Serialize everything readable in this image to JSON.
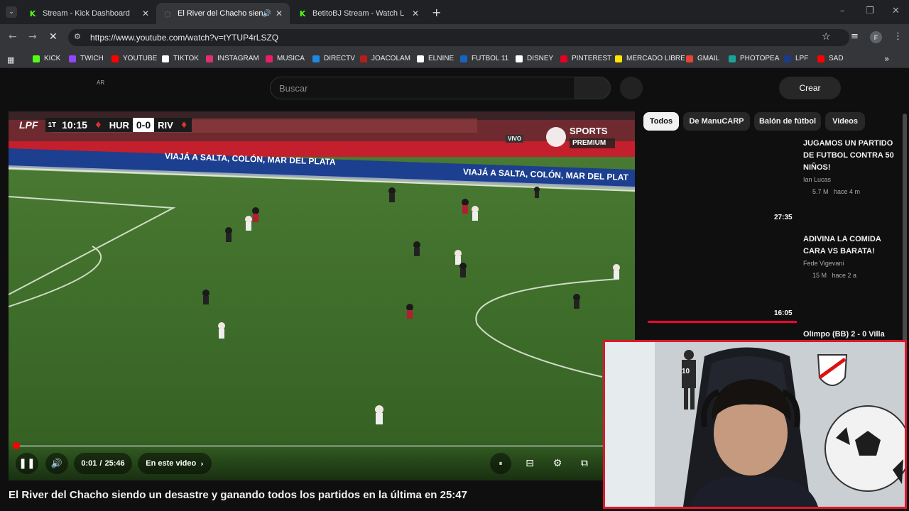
{
  "browser": {
    "tabs": [
      {
        "title": "Stream - Kick Dashboard",
        "favicon": "kick-icon"
      },
      {
        "title": "El River del Chacho siendo",
        "favicon": "youtube-loading-icon",
        "active": true
      },
      {
        "title": "BetitoBJ Stream - Watch Live o",
        "favicon": "kick-icon"
      }
    ],
    "url": "https://www.youtube.com/watch?v=tYTUP4rLSZQ",
    "profile_initial": "F",
    "bookmarks": [
      {
        "label": "KICK",
        "color": "#53fc18"
      },
      {
        "label": "TWICH",
        "color": "#9146ff"
      },
      {
        "label": "YOUTUBE",
        "color": "#ff0000"
      },
      {
        "label": "TIKTOK",
        "color": "#ffffff"
      },
      {
        "label": "INSTAGRAM",
        "color": "#e1306c"
      },
      {
        "label": "MUSICA",
        "color": "#e91e63"
      },
      {
        "label": "DIRECTV",
        "color": "#1e88e5"
      },
      {
        "label": "JOACOLAM",
        "color": "#b71c1c"
      },
      {
        "label": "ELNINE",
        "color": "#ffffff"
      },
      {
        "label": "FUTBOL 11",
        "color": "#1565c0"
      },
      {
        "label": "DISNEY",
        "color": "#ffffff"
      },
      {
        "label": "PINTEREST",
        "color": "#e60023"
      },
      {
        "label": "MERCADO LIBRE",
        "color": "#ffe600"
      },
      {
        "label": "GMAIL",
        "color": "#ea4335"
      },
      {
        "label": "PHOTOPEA",
        "color": "#18a497"
      },
      {
        "label": "LPF",
        "color": "#1a3a8a"
      },
      {
        "label": "SAD",
        "color": "#ff0000"
      }
    ]
  },
  "youtube": {
    "country_code": "AR",
    "search_placeholder": "Buscar",
    "create_label": "Crear"
  },
  "player": {
    "time_current": "0:01",
    "time_separator": "/",
    "time_total": "25:46",
    "chapter_label": "En este video",
    "progress_fraction": 0.001,
    "scorebug": {
      "league": "LPF",
      "half": "1T",
      "clock": "10:15",
      "home": "HUR",
      "score": "0-0",
      "away": "RIV"
    },
    "broadcaster_tag": "VIVO",
    "broadcaster_sub": "PREMIUM",
    "broadcaster_name": "SPORTS",
    "ad_boards": [
      "VIAJÁ A SALTA, COLÓN, MAR DEL PLATA",
      "VIAJÁ A SALTA, COLÓN, MAR DEL PLAT"
    ]
  },
  "video": {
    "title": "El River del Chacho siendo un desastre y ganando todos los partidos en la última en 25:47"
  },
  "chips": [
    "Todos",
    "De ManuCARP",
    "Balón de fútbol",
    "Videos"
  ],
  "recommendations": [
    {
      "title": "JUGAMOS UN PARTIDO DE FUTBOL CONTRA 50 NIÑOS!",
      "channel": "Ian Lucas",
      "meta": "5.7 M   hace 4 m",
      "duration": "27:35"
    },
    {
      "title": "ADIVINA LA COMIDA CARA VS BARATA!",
      "channel": "Fede Vigevani",
      "meta": "15 M   hace 2 a",
      "duration": "16:05"
    },
    {
      "title": "Olimpo (BB) 2 - 0 Villa",
      "channel": "",
      "meta": "",
      "duration": ""
    }
  ],
  "webcam": {
    "jersey_number": "10"
  },
  "colors": {
    "accent_red": "#ff0000",
    "cam_border": "#e0162b",
    "kick_green": "#53fc18"
  }
}
